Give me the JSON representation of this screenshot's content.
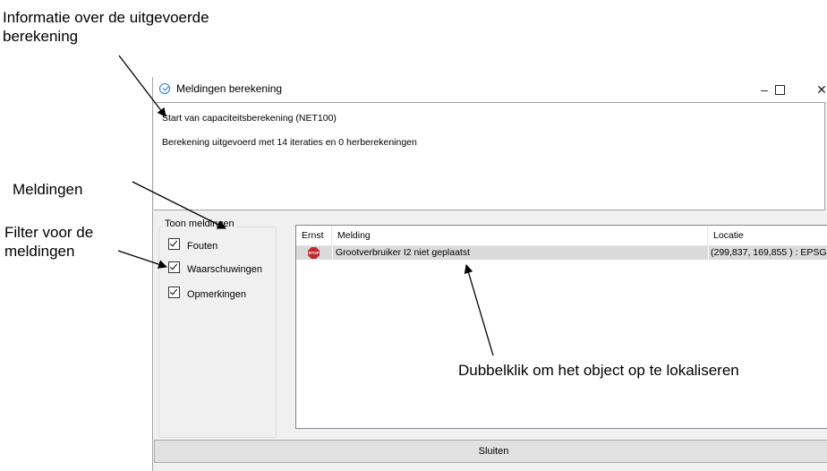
{
  "annotations": {
    "info": "Informatie over de uitgevoerde berekening",
    "meldingen": "Meldingen",
    "filter": "Filter voor de meldingen",
    "dubbelklik": "Dubbelklik om het object op te lokaliseren"
  },
  "window": {
    "title": "Meldingen berekening",
    "minimize": "–",
    "close": "✕"
  },
  "info_pane": {
    "line1": "Start van capaciteitsberekening  (NET100)",
    "line2": "Berekening uitgevoerd met 14 iteraties en 0 herberekeningen"
  },
  "filter": {
    "legend": "Toon meldingen",
    "items": [
      {
        "label": "Fouten",
        "checked": true
      },
      {
        "label": "Waarschuwingen",
        "checked": true
      },
      {
        "label": "Opmerkingen",
        "checked": true
      }
    ]
  },
  "grid": {
    "columns": [
      "Ernst",
      "Melding",
      "Locatie"
    ],
    "rows": [
      {
        "ernst_icon": "stop-sign-icon",
        "ernst_icon_text": "STOP",
        "melding": "Grootverbruiker I2 niet geplaatst",
        "locatie": "(299,837, 169,855 ) : EPSG"
      }
    ]
  },
  "buttons": {
    "close": "Sluiten"
  },
  "colors": {
    "accent": "#1f7bd6",
    "stop": "#c1272d",
    "selected_row": "#dadada"
  }
}
